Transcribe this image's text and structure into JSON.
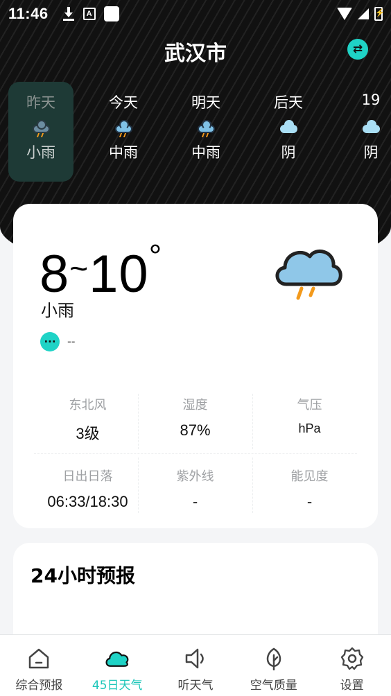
{
  "status_bar": {
    "time": "11:46",
    "a_badge": "A"
  },
  "header": {
    "city": "武汉市",
    "switch_icon": "swap-icon",
    "accent_color": "#1fd3c6"
  },
  "days": [
    {
      "name": "昨天",
      "condition": "小雨",
      "icon": "rain-cloud-icon",
      "selected": true
    },
    {
      "name": "今天",
      "condition": "中雨",
      "icon": "rain-cloud-icon",
      "selected": false
    },
    {
      "name": "明天",
      "condition": "中雨",
      "icon": "rain-cloud-icon",
      "selected": false
    },
    {
      "name": "后天",
      "condition": "阴",
      "icon": "cloud-icon",
      "selected": false
    },
    {
      "name": "19",
      "condition": "阴",
      "icon": "cloud-icon",
      "selected": false
    }
  ],
  "today": {
    "temp_low": "8",
    "tilde": "~",
    "temp_high": "10",
    "degree": "°",
    "condition": "小雨",
    "notice": "--"
  },
  "metrics": [
    {
      "label": "东北风",
      "value": "3级"
    },
    {
      "label": "湿度",
      "value": "87%"
    },
    {
      "label": "气压",
      "value": "hPa"
    },
    {
      "label": "日出日落",
      "value": "06:33/18:30"
    },
    {
      "label": "紫外线",
      "value": "-"
    },
    {
      "label": "能见度",
      "value": "-"
    }
  ],
  "forecast": {
    "title": "24小时预报"
  },
  "bottom_nav": [
    {
      "label": "综合预报",
      "icon": "home-icon",
      "active": false
    },
    {
      "label": "45日天气",
      "icon": "cloud-icon",
      "active": true
    },
    {
      "label": "听天气",
      "icon": "speaker-icon",
      "active": false
    },
    {
      "label": "空气质量",
      "icon": "leaf-icon",
      "active": false
    },
    {
      "label": "设置",
      "icon": "gear-icon",
      "active": false
    }
  ]
}
